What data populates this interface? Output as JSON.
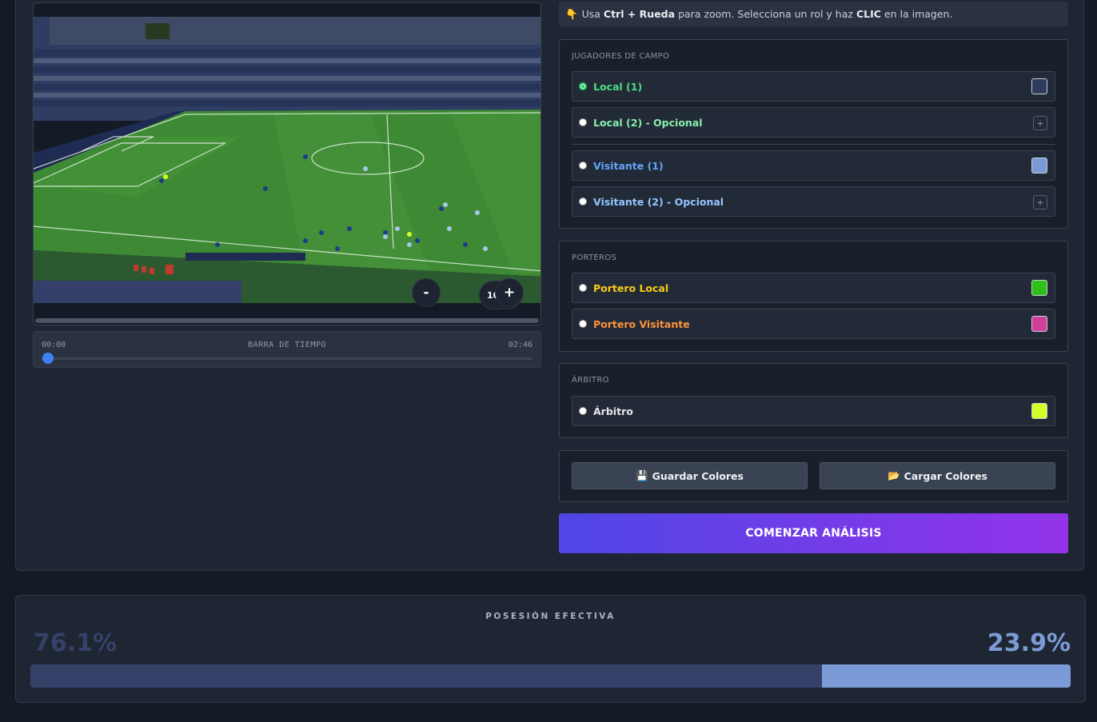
{
  "video": {
    "zoom_out_label": "-",
    "zoom_level": "100%",
    "zoom_in_label": "+"
  },
  "timeline": {
    "start": "00:00",
    "label": "BARRA DE TIEMPO",
    "end": "02:46",
    "progress": 0.0
  },
  "hint": {
    "icon": "👇",
    "text_1": "Usa",
    "key_1": "Ctrl + Rueda",
    "text_2": "para zoom. Selecciona un rol y haz",
    "key_2": "CLIC",
    "text_3": "en la imagen."
  },
  "field_players": {
    "title": "JUGADORES DE CAMPO",
    "roles": [
      {
        "label": "Local (1)",
        "color": "#2f3a5c",
        "label_color": "#4ade80",
        "selected": true
      },
      {
        "label": "Local (2) - Opcional",
        "color": "",
        "label_color": "#86efac",
        "selected": false
      },
      {
        "label": "Visitante (1)",
        "color": "#7b9ad6",
        "label_color": "#60a5fa",
        "selected": false
      },
      {
        "label": "Visitante (2) - Opcional",
        "color": "",
        "label_color": "#93c5fd",
        "selected": false
      }
    ],
    "add_label": "+"
  },
  "goalkeepers": {
    "title": "PORTEROS",
    "roles": [
      {
        "label": "Portero Local",
        "color": "#2ec01a",
        "label_color": "#facc15"
      },
      {
        "label": "Portero Visitante",
        "color": "#d0409a",
        "label_color": "#fb923c"
      }
    ]
  },
  "referee": {
    "title": "ÁRBITRO",
    "roles": [
      {
        "label": "Árbitro",
        "color": "#d6ff2a",
        "label_color": "#e5e7eb"
      }
    ]
  },
  "actions": {
    "save_icon": "💾",
    "save_label": "Guardar Colores",
    "load_icon": "📂",
    "load_label": "Cargar Colores",
    "start_label": "COMENZAR ANÁLISIS"
  },
  "possession": {
    "title": "POSESIÓN EFECTIVA",
    "left_label": "76.1%",
    "right_label": "23.9%",
    "left_value": 76.1,
    "right_value": 23.9,
    "left_color": "#36416a",
    "right_color": "#7c9bd6"
  }
}
